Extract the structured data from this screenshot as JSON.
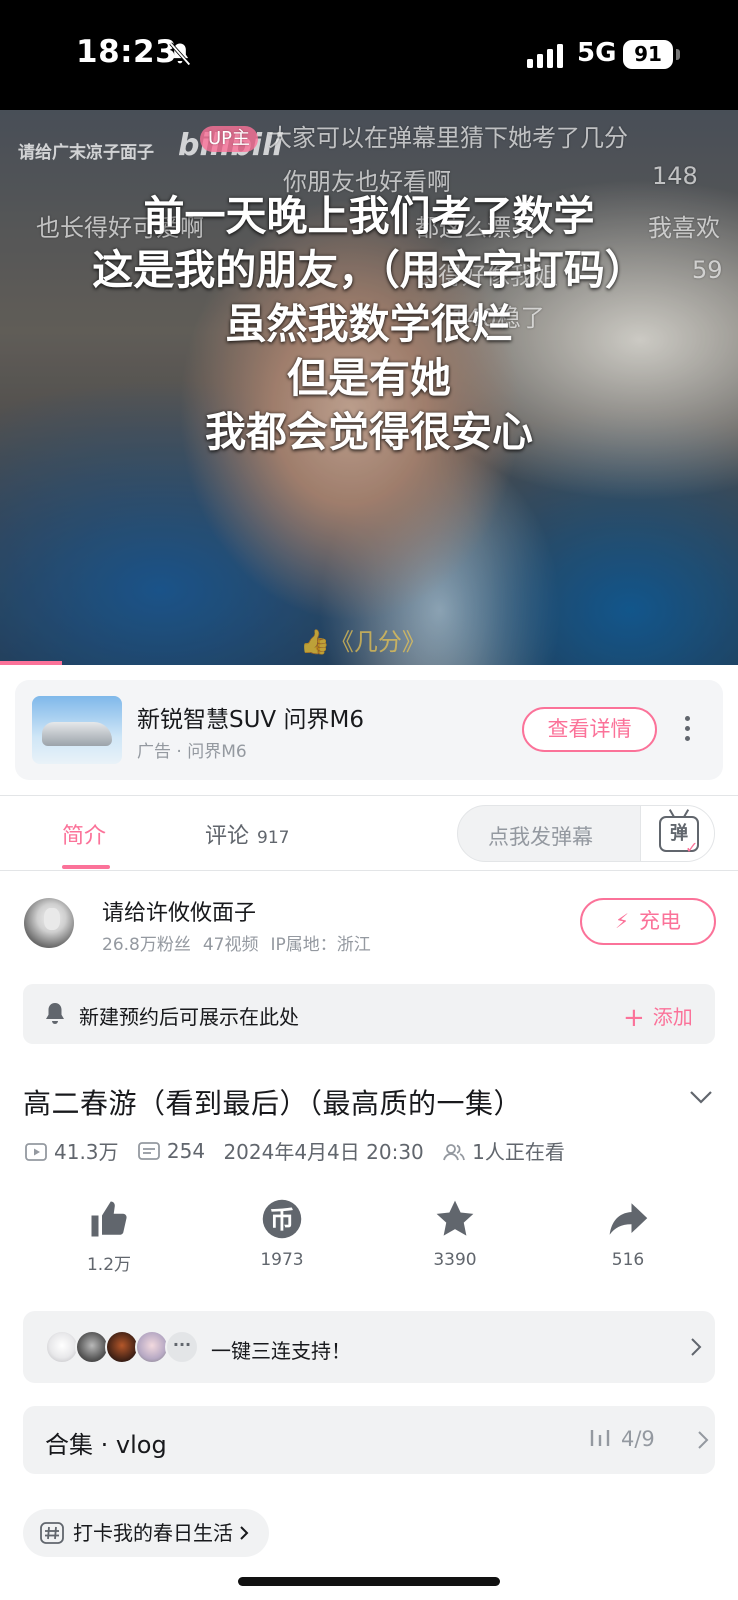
{
  "status_bar": {
    "time": "18:23",
    "network": "5G",
    "battery": "91"
  },
  "video": {
    "watermark_user": "请给广末凉子面子",
    "watermark_logo": "bilibili",
    "up_badge": "UP主",
    "danmaku": [
      "大家可以在弹幕里猜下她考了几分",
      "你朋友也好看啊",
      "148",
      "也长得好可爱啊",
      "都这么漂亮",
      "我喜欢",
      "长得好像我姐",
      "59",
      "140稳了"
    ],
    "subtitles": [
      "前一天晚上我们考了数学",
      "这是我的朋友，（用文字打码）",
      "虽然我数学很烂",
      "但是有她",
      "我都会觉得很安心"
    ],
    "bottom_tag": "《几分》",
    "progress": 0.084
  },
  "ad": {
    "title": "新锐智慧SUV 问界M6",
    "subtitle": "广告 · 问界M6",
    "button": "查看详情"
  },
  "tabs": {
    "intro": "简介",
    "comments": "评论",
    "comment_count": "917",
    "danmaku_placeholder": "点我发弹幕",
    "danmaku_icon": "弹"
  },
  "uploader": {
    "name": "请给许攸攸面子",
    "fans": "26.8万粉丝",
    "videos": "47视频",
    "ip": "IP属地：浙江",
    "charge": "充电"
  },
  "reservation": {
    "text": "新建预约后可展示在此处",
    "add": "添加"
  },
  "video_info": {
    "title": "高二春游（看到最后）（最高质的一集）",
    "views": "41.3万",
    "danmaku_count": "254",
    "date": "2024年4月4日 20:30",
    "watching": "1人正在看"
  },
  "actions": {
    "like": "1.2万",
    "coin": "1973",
    "favorite": "3390",
    "share": "516"
  },
  "triple": {
    "text": "一键三连支持！"
  },
  "collection": {
    "label": "合集 · vlog",
    "progress": "4/9"
  },
  "topic": {
    "label": "打卡我的春日生活"
  },
  "colors": {
    "accent": "#fb7299",
    "text": "#18191c",
    "secondary": "#61666d",
    "muted": "#9499a0"
  },
  "icons": [
    "bell-off-icon",
    "signal-icon",
    "bell-icon",
    "bolt-icon",
    "chevron-down-icon",
    "play-count-icon",
    "danmaku-count-icon",
    "viewers-icon",
    "like-icon",
    "coin-icon",
    "favorite-icon",
    "share-icon",
    "chevron-right-icon",
    "bars-icon",
    "hashtag-icon"
  ]
}
